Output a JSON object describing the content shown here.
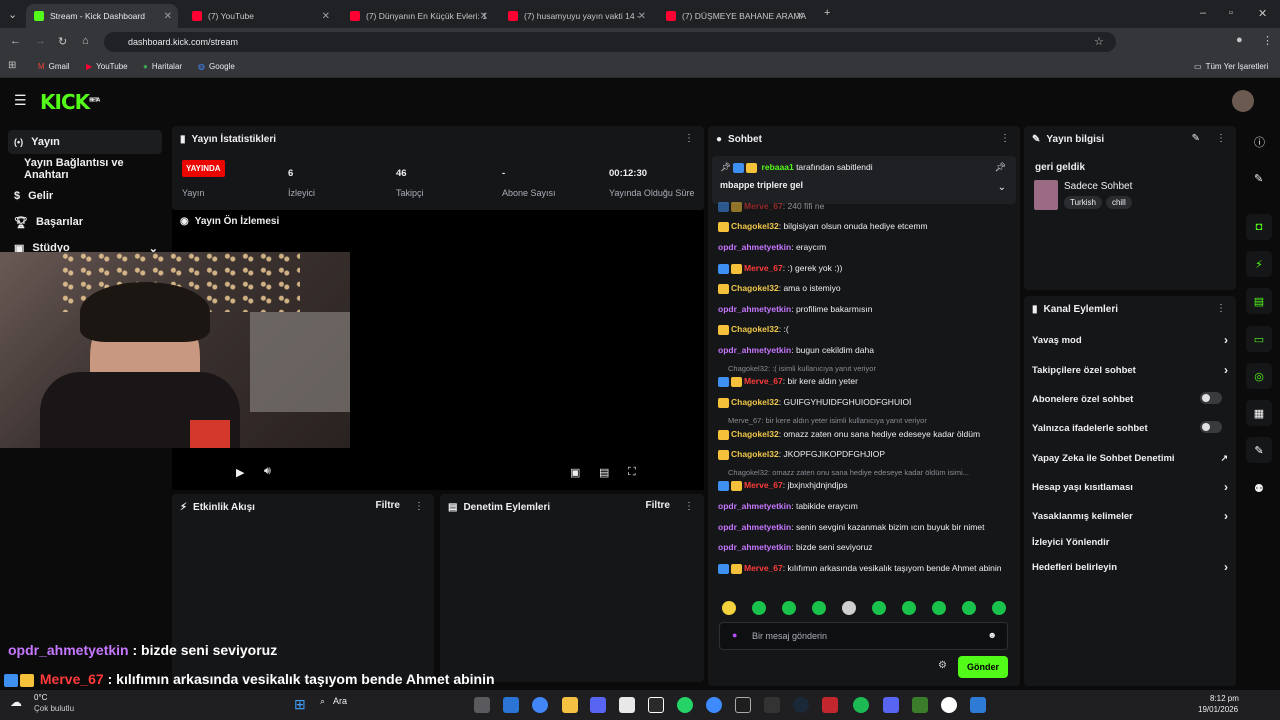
{
  "browser": {
    "tabs": [
      {
        "label": "Stream - Kick Dashboard",
        "color": "#53fc18"
      },
      {
        "label": "(7) YouTube",
        "color": "#ff0033"
      },
      {
        "label": "(7) Dünyanın En Küçük Evleri: 1",
        "color": "#ff0033"
      },
      {
        "label": "(7) husamyuyu yayın vakti 14 -",
        "color": "#ff0033"
      },
      {
        "label": "(7) DÜŞMEYE BAHANE ARAMA",
        "color": "#ff0033"
      }
    ],
    "url": "dashboard.kick.com/stream",
    "bookmarks": [
      "Gmail",
      "YouTube",
      "Haritalar",
      "Google"
    ],
    "all_bookmarks": "Tüm Yer İşaretleri"
  },
  "header": {
    "logo": "KICK",
    "logo_sup": "BETA"
  },
  "sidebar": {
    "items": [
      {
        "label": "Yayın"
      },
      {
        "label": "Yayın Bağlantısı ve Anahtarı"
      },
      {
        "label": "Gelir"
      },
      {
        "label": "Başarılar"
      },
      {
        "label": "Stüdyo"
      }
    ]
  },
  "stats": {
    "title": "Yayın İstatistikleri",
    "live_badge": "YAYINDA",
    "live_label": "Yayın",
    "viewers": "6",
    "viewers_label": "İzleyici",
    "followers": "46",
    "followers_label": "Takipçi",
    "subs": "-",
    "subs_label": "Abone Sayısı",
    "uptime": "00:12:30",
    "uptime_label": "Yayında Olduğu Süre"
  },
  "preview": {
    "title": "Yayın Ön İzlemesi"
  },
  "activity": {
    "title": "Etkinlik Akışı",
    "filter": "Filtre"
  },
  "moderation": {
    "title": "Denetim Eylemleri",
    "filter": "Filtre"
  },
  "chat": {
    "title": "Sohbet",
    "pinned_by": "rebaaa1",
    "pinned_suffix": "tarafından sabitlendi",
    "pinned_msg": "mbappe triplere gel",
    "placeholder": "Bir mesaj gönderin",
    "send": "Gönder",
    "messages": [
      {
        "user": "Merve_67",
        "text": "240 fifi ne",
        "cls": "user-red",
        "badges": "bc"
      },
      {
        "user": "Chagokel32",
        "text": "bilgisiyarı olsun onuda hediye etcemm",
        "cls": "user-gold",
        "badges": "c"
      },
      {
        "user": "opdr_ahmetyetkin",
        "text": "eraycım",
        "cls": "user-purple",
        "badges": ""
      },
      {
        "user": "Merve_67",
        "text": ":) gerek yok :))",
        "cls": "user-red",
        "badges": "bc"
      },
      {
        "user": "Chagokel32",
        "text": "ama o istemiyo",
        "cls": "user-gold",
        "badges": "c"
      },
      {
        "user": "opdr_ahmetyetkin",
        "text": "profilime bakarmısın",
        "cls": "user-purple",
        "badges": ""
      },
      {
        "user": "Chagokel32",
        "text": ":(",
        "cls": "user-gold",
        "badges": "c"
      },
      {
        "user": "opdr_ahmetyetkin",
        "text": "bugun cekildim daha",
        "cls": "user-purple",
        "badges": ""
      },
      {
        "user": "Merve_67",
        "text": "bir kere aldın yeter",
        "cls": "user-red",
        "badges": "bc"
      },
      {
        "user": "Chagokel32",
        "text": "GUIFGYHUIDFGHUIODFGHUIOİ",
        "cls": "user-gold",
        "badges": "c"
      },
      {
        "user": "Chagokel32",
        "text": "omazz zaten onu sana hediye edeseye kadar öldüm",
        "cls": "user-gold",
        "badges": "c"
      },
      {
        "user": "Chagokel32",
        "text": "JKOPFGJIKOPDFGHJIOP",
        "cls": "user-gold",
        "badges": "c"
      },
      {
        "user": "Merve_67",
        "text": "jbxjnxhjdnjndjps",
        "cls": "user-red",
        "badges": "bc"
      },
      {
        "user": "opdr_ahmetyetkin",
        "text": "tabikide eraycım",
        "cls": "user-purple",
        "badges": ""
      },
      {
        "user": "opdr_ahmetyetkin",
        "text": "senin sevgini kazanmak bizim ıcın buyuk bir nimet",
        "cls": "user-purple",
        "badges": ""
      },
      {
        "user": "opdr_ahmetyetkin",
        "text": "bizde seni seviyoruz",
        "cls": "user-purple",
        "badges": ""
      },
      {
        "user": "Merve_67",
        "text": "kılıfımın arkasında vesikalık taşıyom bende Ahmet abinin",
        "cls": "user-red",
        "badges": "bc"
      }
    ],
    "replies": [
      "Chagokel32: :( isimli kullanıcıya yanıt veriyor",
      "Merve_67: bir kere aldın yeter isimli kullanıcıya yanıt veriyor",
      "Chagokel32: omazz zaten onu sana hediye edeseye kadar öldüm isimi..."
    ]
  },
  "info": {
    "title": "Yayın bilgisi",
    "stream_title": "geri geldik",
    "category": "Sadece Sohbet",
    "tags": [
      "Turkish",
      "chill"
    ]
  },
  "channel_actions": {
    "title": "Kanal Eylemleri",
    "items": [
      "Yavaş mod",
      "Takipçilere özel sohbet",
      "Abonelere özel sohbet",
      "Yalnızca ifadelerle sohbet",
      "Yapay Zeka ile Sohbet Denetimi",
      "Hesap yaşı kısıtlaması",
      "Yasaklanmış kelimeler",
      "İzleyici Yönlendir",
      "Hedefleri belirleyin"
    ]
  },
  "overlay": {
    "line1_user": "opdr_ahmetyetkin",
    "line1_text": ": bizde seni seviyoruz",
    "line2_user": "Merve_67",
    "line2_text": ": kılıfımın arkasında vesikalık taşıyom bende Ahmet abinin"
  },
  "taskbar": {
    "weather_temp": "0°C",
    "weather_desc": "Çok bulutlu",
    "search": "Ara",
    "time": "8:12 pm",
    "date": "19/01/2026"
  }
}
